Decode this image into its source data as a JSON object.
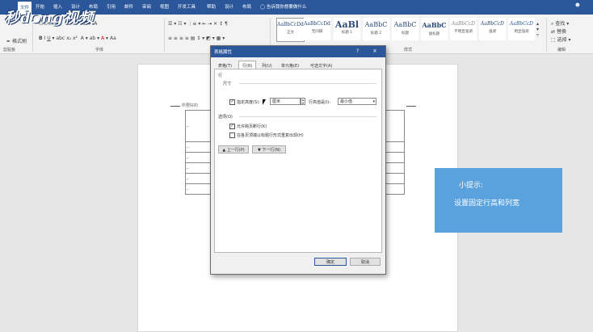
{
  "logo": "秒d๑ng视频",
  "tabs": [
    {
      "label": "文件"
    },
    {
      "label": "开始"
    },
    {
      "label": "插入"
    },
    {
      "label": "设计"
    },
    {
      "label": "布局"
    },
    {
      "label": "引用"
    },
    {
      "label": "邮件"
    },
    {
      "label": "审阅"
    },
    {
      "label": "视图"
    },
    {
      "label": "开发工具"
    },
    {
      "label": "帮助"
    },
    {
      "label": "设计"
    },
    {
      "label": "布局"
    },
    {
      "label": "告诉我你想要做什么"
    }
  ],
  "share_label": "共享",
  "ribbon": {
    "clipboard_label": "剪贴板",
    "paste_format": "格式刷",
    "font_label": "字体",
    "styles_label": "样式",
    "edit_label": "编辑",
    "find_label": "查找",
    "replace_label": "替换",
    "select_label": "选择",
    "styles": [
      {
        "sample": "AaBbCcDd",
        "name": "正文",
        "selected": true
      },
      {
        "sample": "AaBbCcDd",
        "name": "无间隔"
      },
      {
        "sample": "AaBl",
        "name": "标题 1"
      },
      {
        "sample": "AaBbC",
        "name": "标题 2"
      },
      {
        "sample": "AaBbC",
        "name": "标题"
      },
      {
        "sample": "AaBbC",
        "name": "副标题"
      },
      {
        "sample": "AaBbCcD",
        "name": "不明显强调"
      },
      {
        "sample": "AaBbCcD",
        "name": "强调"
      },
      {
        "sample": "AaBbCcD",
        "name": "明显强调"
      }
    ]
  },
  "dialog": {
    "title": "表格属性",
    "help": "?",
    "close": "×",
    "tabs": [
      "表格(T)",
      "行(R)",
      "列(U)",
      "单元格(E)",
      "可选文字(A)"
    ],
    "active_tab": 1,
    "section_row": "行",
    "size_label": "尺寸",
    "specify_height_label": "指定高度(S):",
    "height_value": "厘米",
    "row_height_is_label": "行高值是(I):",
    "row_height_mode": "最小值",
    "options_label": "选项(O)",
    "allow_break_label": "允许跨页断行(K)",
    "repeat_header_label": "在各页顶端以标题行形式重复出现(H)",
    "prev_row": "▲ 上一行(P)",
    "next_row": "▼ 下一行(N)",
    "ok": "确定",
    "cancel": "取消",
    "specify_height_checked": true,
    "allow_break_checked": true,
    "repeat_header_checked": false
  },
  "doc": {
    "table_caption": "所要好的"
  },
  "tip": {
    "heading": "小提示:",
    "body": "设置固定行高和列宽"
  },
  "colors": {
    "ribbon_blue": "#2b579a",
    "tip_blue": "#5aa2dd"
  }
}
